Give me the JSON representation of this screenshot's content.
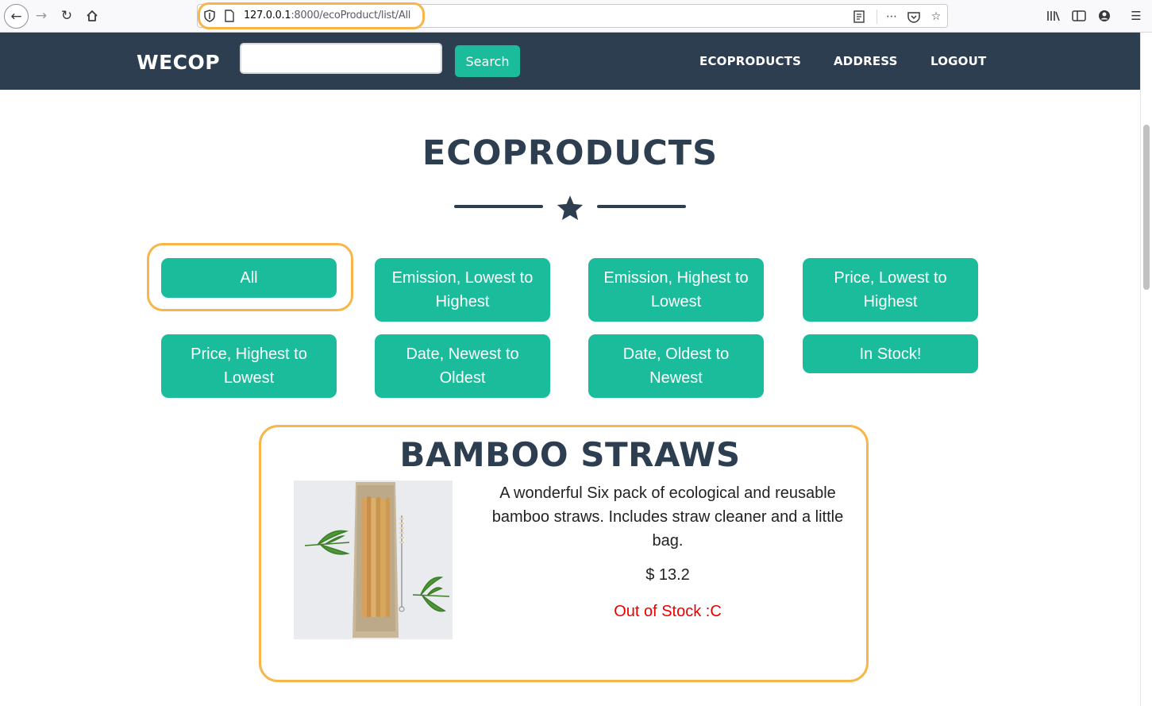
{
  "browser": {
    "url_host": "127.0.0.1",
    "url_path": ":8000/ecoProduct/list/All"
  },
  "nav": {
    "brand": "WECOP",
    "search_value": "",
    "search_button": "Search",
    "links": [
      "ECOPRODUCTS",
      "ADDRESS",
      "LOGOUT"
    ]
  },
  "page": {
    "title": "ECOPRODUCTS"
  },
  "sort_buttons": [
    "All",
    "Emission, Lowest to Highest",
    "Emission, Highest to Lowest",
    "Price, Lowest to Highest",
    "Price, Highest to Lowest",
    "Date, Newest to Oldest",
    "Date, Oldest to Newest",
    "In Stock!"
  ],
  "product": {
    "name": "BAMBOO STRAWS",
    "description": "A wonderful Six pack of ecological and reusable bamboo straws. Includes straw cleaner and a little bag.",
    "price": "$ 13.2",
    "stock": "Out of Stock :C"
  },
  "colors": {
    "nav_bg": "#2c3e50",
    "accent": "#1abc9c",
    "out_of_stock": "#e80000",
    "highlight": "#f8b54a"
  }
}
